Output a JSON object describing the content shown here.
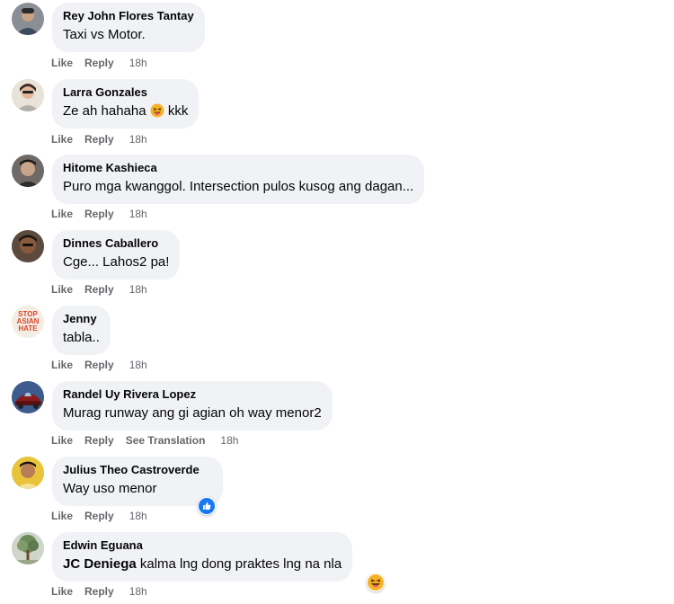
{
  "actions": {
    "like": "Like",
    "reply": "Reply",
    "see_translation": "See Translation"
  },
  "comments": [
    {
      "author": "Rey John Flores Tantay",
      "text": "Taxi vs Motor.",
      "time": "18h",
      "avatar": "person-avatar"
    },
    {
      "author": "Larra Gonzales",
      "text": "Ze ah hahaha",
      "text_after_emoji": "kkk",
      "emoji": "squinting-tongue-emoji",
      "time": "18h",
      "avatar": "person-avatar"
    },
    {
      "author": "Hitome Kashieca",
      "text": "Puro mga kwanggol. Intersection pulos kusog ang dagan...",
      "time": "18h",
      "avatar": "person-avatar"
    },
    {
      "author": "Dinnes Caballero",
      "text": "Cge... Lahos2 pa!",
      "time": "18h",
      "avatar": "person-avatar"
    },
    {
      "author": "Jenny",
      "text": "tabla..",
      "time": "18h",
      "avatar": "stop-asian-hate-avatar",
      "avatar_text": [
        "STOP",
        "ASIAN",
        "HATE"
      ]
    },
    {
      "author": "Randel Uy Rivera Lopez",
      "text": "Murag runway ang gi agian oh way menor2",
      "time": "18h",
      "avatar": "car-avatar",
      "has_translation": true
    },
    {
      "author": "Julius Theo Castroverde",
      "text": "Way uso menor",
      "time": "18h",
      "avatar": "person-avatar",
      "reaction": "like"
    },
    {
      "author": "Edwin Eguana",
      "mention": "JC Deniega",
      "text": " kalma lng dong praktes lng na nla",
      "time": "18h",
      "avatar": "tree-avatar",
      "reaction": "haha"
    }
  ],
  "colors": {
    "bubble": "#f0f2f5",
    "meta": "#65676b",
    "like_blue": "#1877f2",
    "haha_yellow": "#f7b125"
  }
}
